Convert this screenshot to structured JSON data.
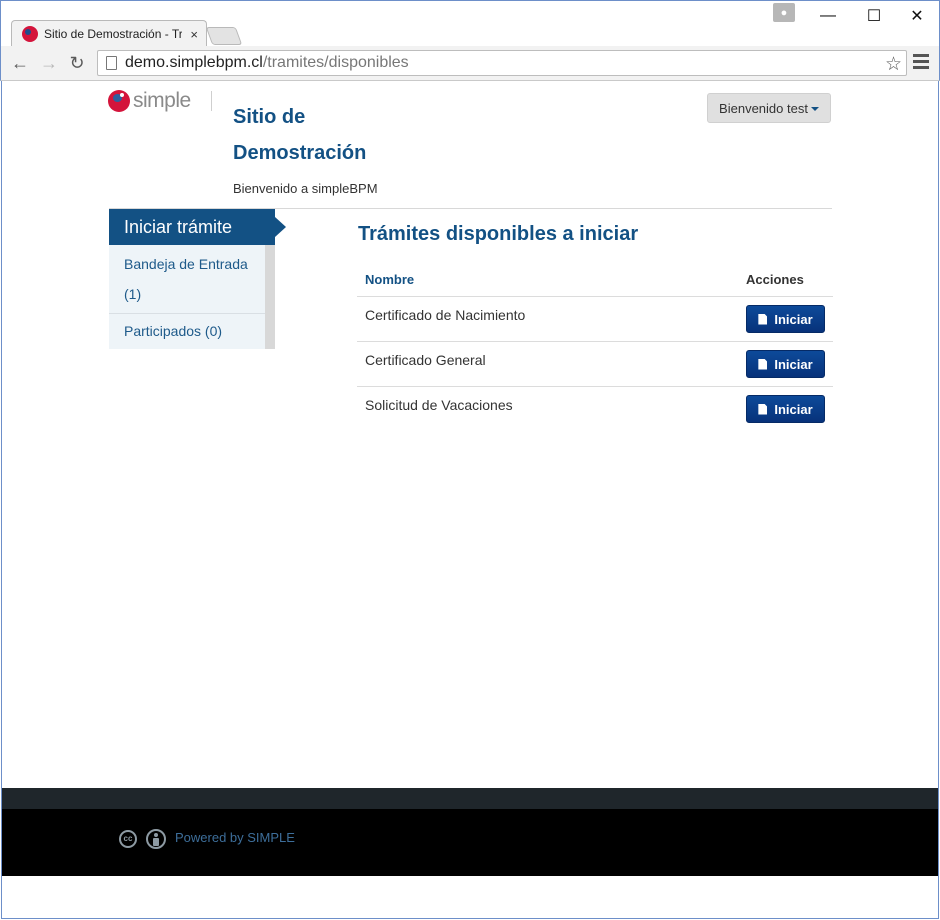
{
  "browser": {
    "tab_title": "Sitio de Demostración - Trámites",
    "tab_close": "×",
    "url_host": "demo.simplebpm.cl",
    "url_path": "/tramites/disponibles",
    "minimize": "—",
    "maximize": "☐",
    "close": "✕"
  },
  "header": {
    "logo_text": "simple",
    "site_title": "Sitio de Demostración",
    "welcome": "Bienvenido a simpleBPM",
    "user_button": "Bienvenido test"
  },
  "sidebar": {
    "active": "Iniciar trámite",
    "items": [
      {
        "label": "Bandeja de Entrada (1)"
      },
      {
        "label": "Participados (0)"
      }
    ]
  },
  "main": {
    "title": "Trámites disponibles a iniciar",
    "columns": {
      "name": "Nombre",
      "actions": "Acciones"
    },
    "rows": [
      {
        "name": "Certificado de Nacimiento",
        "action": "Iniciar"
      },
      {
        "name": "Certificado General",
        "action": "Iniciar"
      },
      {
        "name": "Solicitud de Vacaciones",
        "action": "Iniciar"
      }
    ]
  },
  "footer": {
    "powered": "Powered by SIMPLE",
    "cc_text": "cc"
  },
  "colors": {
    "primary": "#135184",
    "button": "#0d4a9a",
    "footer": "#000000"
  }
}
